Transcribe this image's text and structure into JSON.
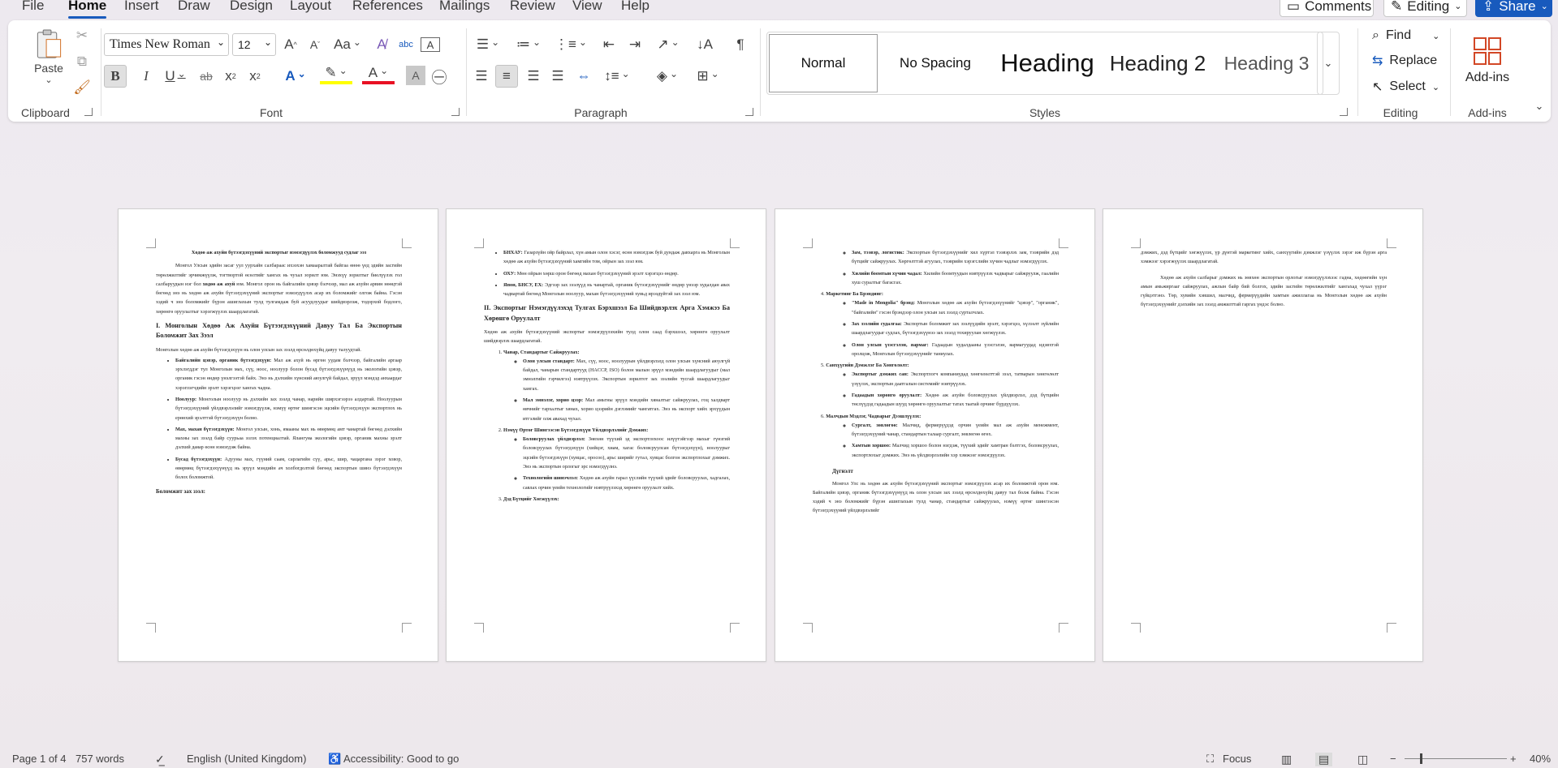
{
  "menu": {
    "tabs": [
      "File",
      "Home",
      "Insert",
      "Draw",
      "Design",
      "Layout",
      "References",
      "Mailings",
      "Review",
      "View",
      "Help"
    ],
    "active_tab": "Home",
    "comments": "Comments",
    "editing": "Editing",
    "share": "Share"
  },
  "ribbon": {
    "clipboard": {
      "paste": "Paste",
      "label": "Clipboard"
    },
    "font": {
      "family": "Times New Roman",
      "size": "12",
      "case": "Aa",
      "label": "Font"
    },
    "paragraph": {
      "label": "Paragraph"
    },
    "styles": {
      "items": [
        "Normal",
        "No Spacing",
        "Heading",
        "Heading 2",
        "Heading 3"
      ],
      "label": "Styles"
    },
    "editing": {
      "find": "Find",
      "replace": "Replace",
      "select": "Select",
      "label": "Editing"
    },
    "addins": {
      "button": "Add-ins",
      "label": "Add-ins"
    }
  },
  "pages": {
    "p1": {
      "title": "Хөдөө аж ахуйн бүтээгдэхүүний экспортыг нэмэгдүүлэх боломжууд судлаг ээз",
      "intro_a": "Монгол Улсын эдийн засаг уул уурхайн салбараас ихээхэн хамааралтай байгаа өнөө үед эдийн засгийн төрөлжилтийг эрчимжүүлж, тогтвортой өсөлтийг хангах нь чухал зорилт юм. Энэхүү зорилтыг биелүүлэх гол салбаруудын нэг бол",
      "intro_bold": "хөдөө аж ахуй",
      "intro_b": "юм. Монгол орон нь байгалийн цэвэр бэлчээр, мал аж ахуйн арвин нөөцтэй бөгөөд энэ нь хөдөө аж ахуйн бүтээгдэхүүний экспортыг нэмэгдүүлэх асар их боломжийг олгож байна. Гэсэн хэдий ч энэ боломжийг бүрэн ашиглахын тулд тулгамдаж буй асуудлуудыг шийдвэрлэж, тодорхой бодлого, хөрөнгө оруулалтыг хэрэгжүүлэх шаардлагатай.",
      "h1": "I. Монголын Хөдөө Аж Ахуйн Бүтээгдэхүүний Давуу Тал Ба Экспортын Боломжит Зах Зээл",
      "h1_text": "Монголын хөдөө аж ахуйн бүтээгдэхүүн нь олон улсын зах зээлд өрсөлдөхүйц давуу талуудтай.",
      "bullets": [
        {
          "b": "Байгалийн цэвэр, органик бүтээгдэхүүн:",
          "t": "Мал аж ахуй нь өргөн уудам бэлчээр, байгалийн аргаар эрхлэгддэг тул Монголын мах, сүү, ноос, ноолуур болон бусад бүтээгдэхүүнүүд нь экологийн цэвэр, органик гэсэн өндөр үнэлгээтэй байх. Энэ нь дэлхийн хүнсний аюулгүй байдал, эрүүл мэндэд анхаардаг хэрэглэгчдийн эрэлт хэрэгцээг хангах чадна."
        },
        {
          "b": "Ноолуур:",
          "t": "Монголын ноолуур нь дэлхийн зах зээлд чанар, нарийн ширхэгээрээ алдартай. Ноолуурын бүтээгдэхүүний үйлдвэрлэлийг нэмэгдүүлж, нэмүү өртөг шингэсэн эцсийн бүтээгдэхүүн экспортлох нь ерөнхий эрэлттэй бүтээгдэхүүн болно."
        },
        {
          "b": "Мах, махан бүтээгдэхүүн:",
          "t": "Монгол улсын, хонь, ямааны мах нь өвөрмөц амт чанартай бөгөөд дэлхийн махны зах зээлд байр суурьаа эзлэх потенциалтай. Ялангуяа экологийн цэвэр, органик махны эрэлт дэлхий даяар өсөн нэмэгдэж байна."
        },
        {
          "b": "Бусад бүтээгдэхүүн:",
          "t": "Адууны мах, гүүний саам, сарлагийн сүү, арьс, шир, чацаргана зэрэг ховор, өвөрмөц бүтээгдэхүүнүүд нь эрүүл мэндийн ач холбогдолтой бөгөөд экспортын шинэ бүтээгдэхүүн болох боломжтой."
        }
      ],
      "footer_head": "Боломжит зах зээл:"
    },
    "p2": {
      "bullets": [
        {
          "b": "БНХАУ:",
          "t": "Газарзүйн ойр байрлал, хүн амын олон хэсэг, өсөн нэмэгдэж буй дундаж давхарга нь Монголын хөдөө аж ахуйн бүтээгдэхүүний хамгийн том, ойрын зах зээл юм."
        },
        {
          "b": "ОХУ:",
          "t": "Мөн ойрын хөрш орон бөгөөд махан бүтээгдэхүүний эрэлт хэрэгцээ өндөр."
        },
        {
          "b": "Япон, БНСУ, ЕХ:",
          "t": "Эдгээр зах зээлүүд нь чанартай, органик бүтээгдэхүүнийг өндөр үнээр худалдан авах чадвартай бөгөөд Монголын ноолуур, махан бүтээгдэхүүний хувьд ирээдүйтэй зах зээл юм."
        }
      ],
      "h2": "II. Экспортыг Нэмэгдүүлэхэд Тулгах Бэрхшээл Ба Шийдвэрлэх Арга Хэмжээ Ба Хөрөнгө Оруулалт",
      "h2_text": "Хөдөө аж ахуйн бүтээгдэхүүний экспортыг нэмэгдүүлэхийн тулд олон саад бэрхшээл, хөрөнгө оруулалт шийдвэрлэх шаардлагатай.",
      "items": [
        {
          "t": "Чанар, Стандартыг Сайжруулах:",
          "subs": [
            {
              "b": "Олон улсын стандарт:",
              "t": "Мах, сүү, ноос, ноолуурын үйлдвэрлэлд олон улсын хүнсний аюулгүй байдал, чанарын стандартууд (HACCP, ISO) болон малын эрүүл мэндийн шаардлагуудыг (мал эмнэлгийн гэрчилгээ) нэвтрүүлэх. Экспортын зорилтот зах зээлийн тусгай шаардлагуудыг хангах."
            },
            {
              "b": "Мал эмнэлэг, хорио цээр:",
              "t": "Мал амьтны эрүүл мэндийн хяналтыг сайжруулах, гоц халдварт өвчнийг тархалтыг хянах, хорио цээрийн дэглэмийг чангатгах. Энэ нь экспорт хийх эрхүүдын итгэлийг олж авахад чухал."
            }
          ]
        },
        {
          "t": "Нэмүү Өртөг Шингээсэн Бүтээгдэхүүн Үйлдвэрлэлийг Дэмжих:",
          "subs": [
            {
              "b": "Боловсруулах үйлдвэрлэл:",
              "t": "Зөвхөн түүхий эд экспортлохоос илүүтэйгээр махыг гүнзгий боловсруулах бүтээгдэхүүн (хийцэг, хиам, хагас боловсруулсан бүтээгдэхүүн), ноолуурыг эцсийн бүтээгдэхүүн (хувцас, оросоо), арьс ширийг гутал, хувцас болгон экспортлохыг дэмжих. Энэ нь экспортын орлогыг эрс нэмэгдүүлнэ."
            },
            {
              "b": "Технологийн шинэчлэл:",
              "t": "Хөдөө аж ахуйн гарал үүслийн түүхий эдийг боловсруулах, хадгалах, савлах орчин үеийн технологийг нэвтрүүлэхэд хөрөнгө оруулалт хийх."
            }
          ]
        },
        {
          "t": "Дэд Бүтцийг Хөгжүүлэх:",
          "subs": []
        }
      ]
    },
    "p3": {
      "subs_a": [
        {
          "b": "Зам, тээвэр, логистик:",
          "t": "Экспортын бүтээгдэхүүнийг хил хүртэл тээвэрлэх зам, тээврийн дэд бүтцийг сайжруулах. Хөргөлттэй агуулах, тээврийн хэрэгслийн хүчин чадлыг нэмэгдүүлэх."
        },
        {
          "b": "Хилийн боомтын хүчин чадал:",
          "t": "Хилийн боомтуудын нэвтрүүлэх чадварыг сайжруулж, гаалийн хуш суралтыг багасгах."
        }
      ],
      "items": [
        {
          "n": "4.",
          "t": "Маркетинг Ба Брэндинг:",
          "subs": [
            {
              "b": "\"Made in Mongolia\" брэнд:",
              "t": "Монголын хөдөө аж ахуйн бүтээгдэхүүнийг \"цэвэр\", \"органик\", \"байгалийн\" гэсэн брэндээр олон улсын зах зээлд сурталчлах."
            },
            {
              "b": "Зах зээлийн судалгаа:",
              "t": "Экспортын боломжит зах зээлүүдийн эрэлт, хэрэгцээ, хүлээлт зүйлийн шаардлагуудыг судлах, бүтээгдэхүүнээ зах зээлд тохируулан хөгжүүлэх."
            },
            {
              "b": "Олон улсын үзэсгэлэн, яармаг:",
              "t": "Гадаадын худалдааны үзэсгэлэн, яармагуудад идэвхтэй оролцож, Монголын бүтээгдэхүүнийг таниулах."
            }
          ]
        },
        {
          "n": "5.",
          "t": "Санхүүгийн Дэмжлэг Ба Хөнгөлөлт:",
          "subs": [
            {
              "b": "Экспортыг дэмжих сан:",
              "t": "Экспортлогч компаниудад хөнгөлөлттэй зээл, татварын хөнгөлөлт үзүүлэх, экспортын даатгалын системийг нэвтрүүлэх."
            },
            {
              "b": "Гадаадын хөрөнгө оруулалт:",
              "t": "Хөдөө аж ахуйн боловсруулах үйлдвэрлэл, дэд бүтцийн төслүүдэд гадаадын шууд хөрөнгө оруулалтыг татах таатай орчинг бүрдүүлэх."
            }
          ]
        },
        {
          "n": "6.",
          "t": "Малчдын Мэдлэг, Чадварыг Дээшлүүлэх:",
          "subs": [
            {
              "b": "Сургалт, зөвлөгөө:",
              "t": "Малчид, фермерүүдэд орчин үеийн мал аж ахуйн менежмент, бүтээгдэхүүний чанар, стандартын талаар сургалт, зөвлөгөө өгөх."
            },
            {
              "b": "Хамтын хоршоо:",
              "t": "Малчид хоршоо болон нэгдэж, түүхий эдийг хамтран бэлтгэх, боловсруулах, экспортлохыг дэмжих. Энэ нь үйлдвэрлэлийн хэр хэмжээг нэмэгдүүлэх."
            }
          ]
        }
      ],
      "conclusion_head": "Дүгнэлт",
      "conclusion": "Монгол Улс нь хөдөө аж ахуйн бүтээгдэхүүний экспортыг нэмэгдүүлэх асар их боломжтой орон юм. Байгалийн цэвэр, органик бүтээгдэхүүнүүд нь олон улсын зах зээлд өрсөлдөхүйц давуу тал болж байна. Гэсэн хэдий ч энэ боломжийг бүрэн ашиглахын тулд чанар, стандартыг сайжруулах, нэмүү өртөг шингээсэн бүтээгдэхүүний үйлдвэрлэлийг"
    },
    "p4": {
      "cont": "дэмжих, дэд бүтцийг хөгжүүлэх, үр дүнтэй маркетинг хийх, санхүүгийн дэмжлэг үзүүлэх зэрэг иж бүрэн арга хэмжээг хэрэгжүүлэх шаардлагатай.",
      "para": "Хөдөө аж ахуйн салбарыг дэмжих нь зөвхөн экспортын орлогыг нэмэгдүүлэхээс гадна, хөдөөгийн хүн амын амьжиргааг сайжруулах, ажлын байр бий болгох, эдийн засгийн төрөлжилтийг хангахад чухал үүрэг гүйцэтгэнэ. Төр, хувийн хэвшил, малчид, фермерүүдийн хамтын ажиллагаа нь Монголын хөдөө аж ахуйн бүтээгдэхүүнийг дэлхийн зах зээлд амжилттай гаргах үндэс болно."
    }
  },
  "status": {
    "page": "Page 1 of 4",
    "words": "757 words",
    "language": "English (United Kingdom)",
    "accessibility": "Accessibility: Good to go",
    "focus": "Focus",
    "zoom": "40%"
  }
}
